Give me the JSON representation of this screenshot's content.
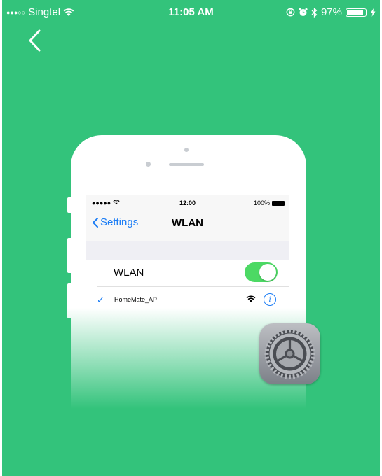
{
  "status_bar": {
    "signal_dots": "●●●○○",
    "carrier": "Singtel",
    "time": "11:05 AM",
    "battery_percent": "97%",
    "battery_level": 0.97
  },
  "navigation": {
    "back_icon": "chevron-left-icon"
  },
  "illustration": {
    "inner_status": {
      "signal": "●●●●● ",
      "time": "12:00",
      "battery": "100%"
    },
    "nav": {
      "back_label": "Settings",
      "title": "WLAN"
    },
    "wlan_row": {
      "label": "WLAN",
      "toggle_on": true
    },
    "network": {
      "name": "HomeMate_AP",
      "selected": true
    },
    "settings_app_icon": "settings-gear-icon"
  },
  "colors": {
    "background": "#33c37b",
    "toggle_on": "#4cd964",
    "ios_blue": "#1a7cf5"
  }
}
